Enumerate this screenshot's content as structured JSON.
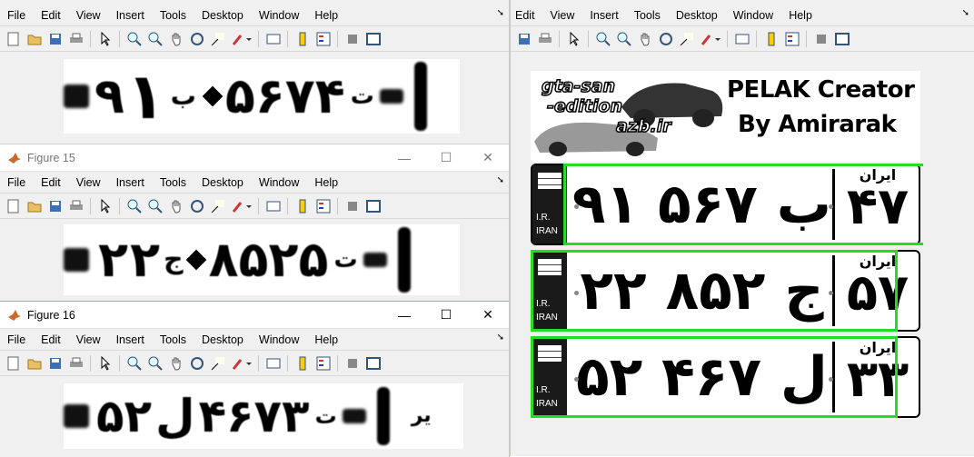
{
  "menus": [
    "File",
    "Edit",
    "View",
    "Insert",
    "Tools",
    "Desktop",
    "Window",
    "Help"
  ],
  "right_menus": [
    "Edit",
    "View",
    "Insert",
    "Tools",
    "Desktop",
    "Window",
    "Help"
  ],
  "menu_overflow_icon": "arrow-icon",
  "toolbar_icons": [
    "new-figure-icon",
    "open-icon",
    "save-icon",
    "print-icon",
    "select-arrow-icon",
    "zoom-in-icon",
    "zoom-out-icon",
    "pan-icon",
    "rotate-3d-icon",
    "data-cursor-icon",
    "brush-icon",
    "link-plot-icon",
    "colorbar-icon",
    "legend-icon",
    "hide-plot-tools-icon",
    "show-plot-tools-icon"
  ],
  "figure15": {
    "title": "Figure 15"
  },
  "figure16": {
    "title": "Figure 16"
  },
  "window_controls": {
    "minimize": "—",
    "maximize": "☐",
    "close": "✕"
  },
  "strip_top": {
    "glyphs": [
      "۹",
      "۱",
      "ب",
      "۵",
      "۶",
      "۷",
      "۴",
      "ت"
    ]
  },
  "strip_mid": {
    "glyphs": [
      "۲",
      "۲",
      "ج",
      "۸",
      "۵",
      "۲",
      "۵",
      "ت"
    ]
  },
  "strip_bottom": {
    "glyphs": [
      "۵",
      "۲",
      "ل",
      "۴",
      "۶",
      "۷",
      "۳",
      "ت"
    ],
    "extra": "یر"
  },
  "banner": {
    "logo_lines": [
      "gta-san",
      "-edition",
      "azb.ir"
    ],
    "title_line1": "PELAK Creator",
    "title_line2": "By Amirarak"
  },
  "plates": [
    {
      "ir_line1": "I.R.",
      "ir_line2": "IRAN",
      "number": "۹۱ ب ۵۶۷",
      "region_label": "ایران",
      "region_number": "۴۷"
    },
    {
      "ir_line1": "I.R.",
      "ir_line2": "IRAN",
      "number": "۲۲ ج ۸۵۲",
      "region_label": "ایران",
      "region_number": "۵۷"
    },
    {
      "ir_line1": "I.R.",
      "ir_line2": "IRAN",
      "number": "۵۲ ل ۴۶۷",
      "region_label": "ایران",
      "region_number": "۳۳"
    }
  ],
  "colors": {
    "detection_box": "#22dd22",
    "window_bg": "#f0f0f0"
  }
}
